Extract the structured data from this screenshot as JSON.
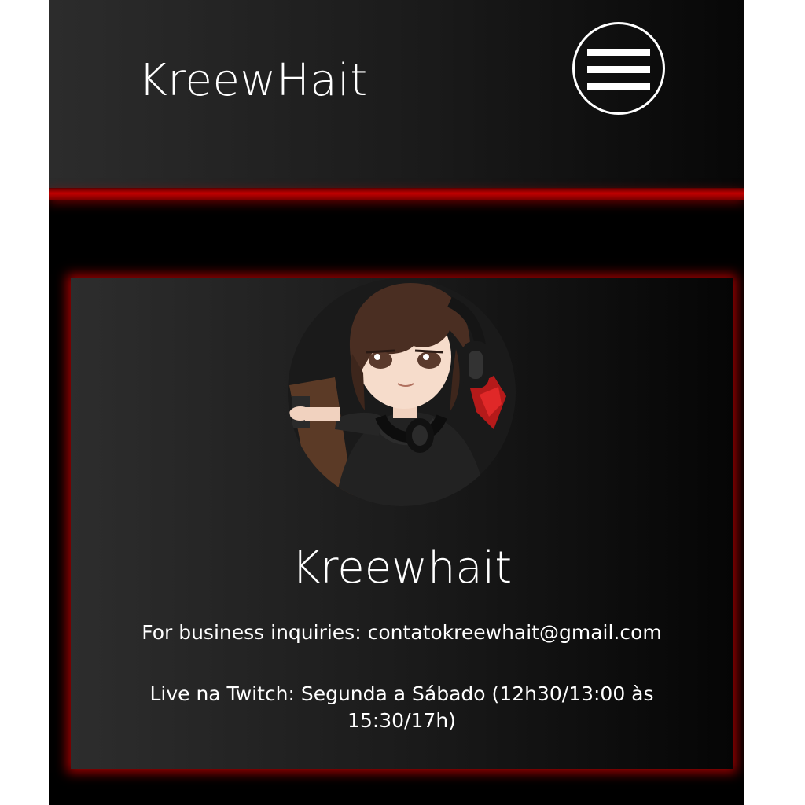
{
  "header": {
    "site_title": "KreewHait",
    "menu_icon": "hamburger-menu-icon"
  },
  "profile": {
    "avatar_icon": "anime-streamer-avatar",
    "name": "Kreewhait",
    "business_line": "For business inquiries: contatokreewhait@gmail.com",
    "schedule_line": "Live na Twitch: Segunda a Sábado (12h30/13:00 às 15:30/17h)"
  },
  "colors": {
    "background": "#000000",
    "accent_red": "#c20000",
    "text": "#ffffff"
  }
}
